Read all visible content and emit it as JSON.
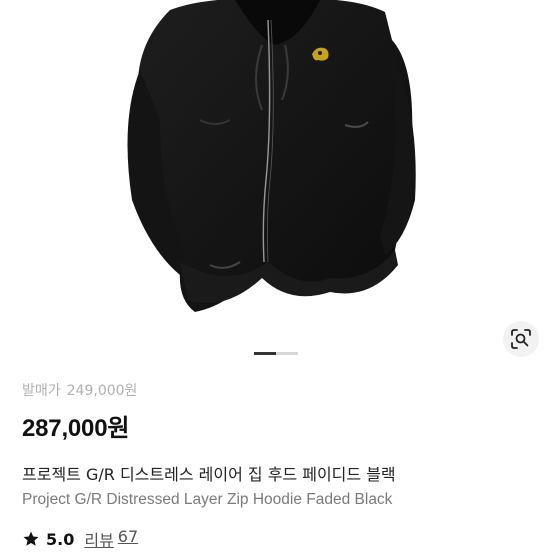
{
  "gallery": {
    "image_description_icon": "black-zip-hoodie-photo",
    "lens_icon": "image-search-lens-icon",
    "slides_total": 2,
    "active_slide": 1
  },
  "product": {
    "release_price_label": "발매가",
    "release_price": "249,000원",
    "price": "287,000원",
    "name_ko": "프로젝트 G/R 디스트레스 레이어 집 후드 페이디드 블랙",
    "name_en": "Project G/R Distressed Layer Zip Hoodie Faded Black",
    "rating": "5.0",
    "review_label": "리뷰",
    "review_count": "67"
  },
  "colors": {
    "price_text": "#111111",
    "muted_text": "#b0b0b0",
    "english_name": "#7a7a7a",
    "active_indicator": "#333333",
    "inactive_indicator": "#d8d8d8"
  }
}
